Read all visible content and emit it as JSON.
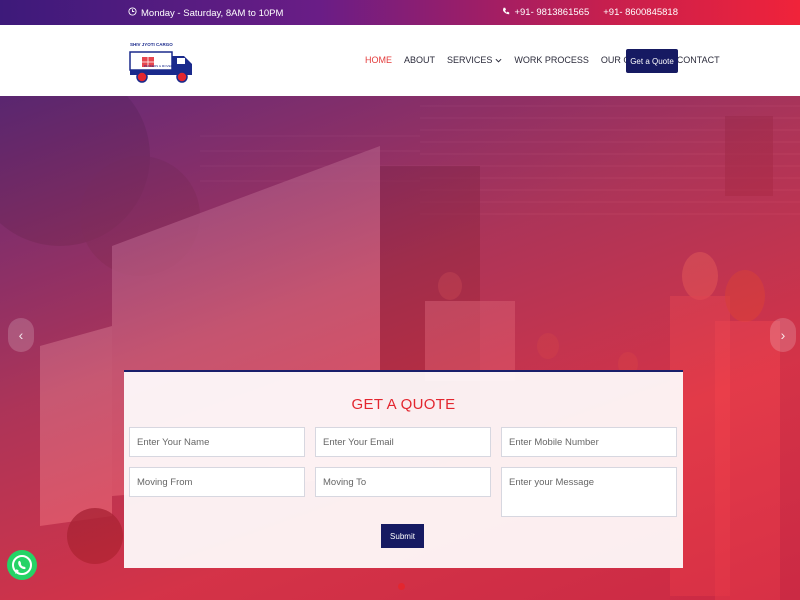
{
  "topbar": {
    "hours": "Monday - Saturday, 8AM to 10PM",
    "phone1": "+91- 9813861565",
    "phone2": "+91- 8600845818"
  },
  "logo": {
    "brand": "SHIV JYOTI CARGO",
    "tagline": "PACKERS & MOVERS"
  },
  "nav": {
    "items": [
      {
        "label": "HOME",
        "active": true
      },
      {
        "label": "ABOUT"
      },
      {
        "label": "SERVICES",
        "dropdown": true
      },
      {
        "label": "WORK PROCESS"
      },
      {
        "label": "OUR GALLERY"
      },
      {
        "label": "CONTACT"
      }
    ],
    "cta": "Get a Quote"
  },
  "hero": {
    "prev_arrow": "‹",
    "next_arrow": "›"
  },
  "quote_form": {
    "title": "GET A QUOTE",
    "name_placeholder": "Enter Your Name",
    "email_placeholder": "Enter Your Email",
    "mobile_placeholder": "Enter Mobile Number",
    "from_placeholder": "Moving From",
    "to_placeholder": "Moving To",
    "message_placeholder": "Enter your Message",
    "submit_label": "Submit"
  },
  "colors": {
    "accent_red": "#e3262f",
    "navy": "#161a62",
    "whatsapp_green": "#25d366"
  }
}
